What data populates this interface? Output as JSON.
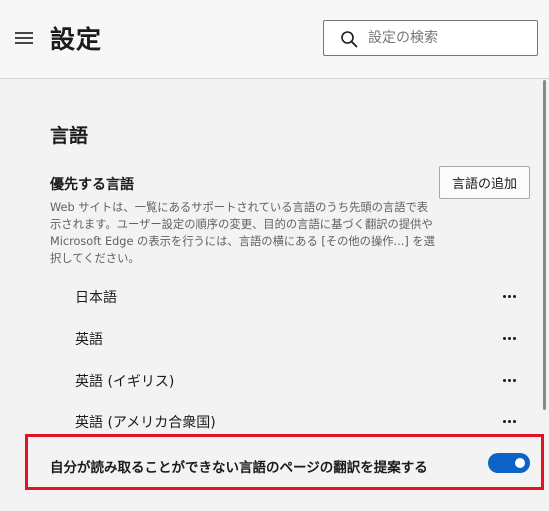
{
  "header": {
    "title": "設定",
    "search": {
      "placeholder": "設定の検索",
      "value": ""
    }
  },
  "section": {
    "title": "言語",
    "preferred_heading": "優先する言語",
    "add_language_label": "言語の追加",
    "description": "Web サイトは、一覧にあるサポートされている言語のうち先頭の言語で表示されます。ユーザー設定の順序の変更、目的の言語に基づく翻訳の提供や Microsoft Edge の表示を行うには、言語の横にある [その他の操作...] を選択してください。",
    "languages": [
      {
        "name": "日本語"
      },
      {
        "name": "英語"
      },
      {
        "name": "英語 (イギリス)"
      },
      {
        "name": "英語 (アメリカ合衆国)"
      }
    ],
    "translate_toggle": {
      "label": "自分が読み取ることができない言語のページの翻訳を提案する",
      "on": true
    }
  },
  "colors": {
    "accent": "#0c63c6",
    "highlight": "#e81123",
    "background": "#f3f3f3"
  },
  "icons": {
    "menu": "hamburger-icon",
    "search": "search-icon",
    "more": "more-horizontal-icon"
  }
}
